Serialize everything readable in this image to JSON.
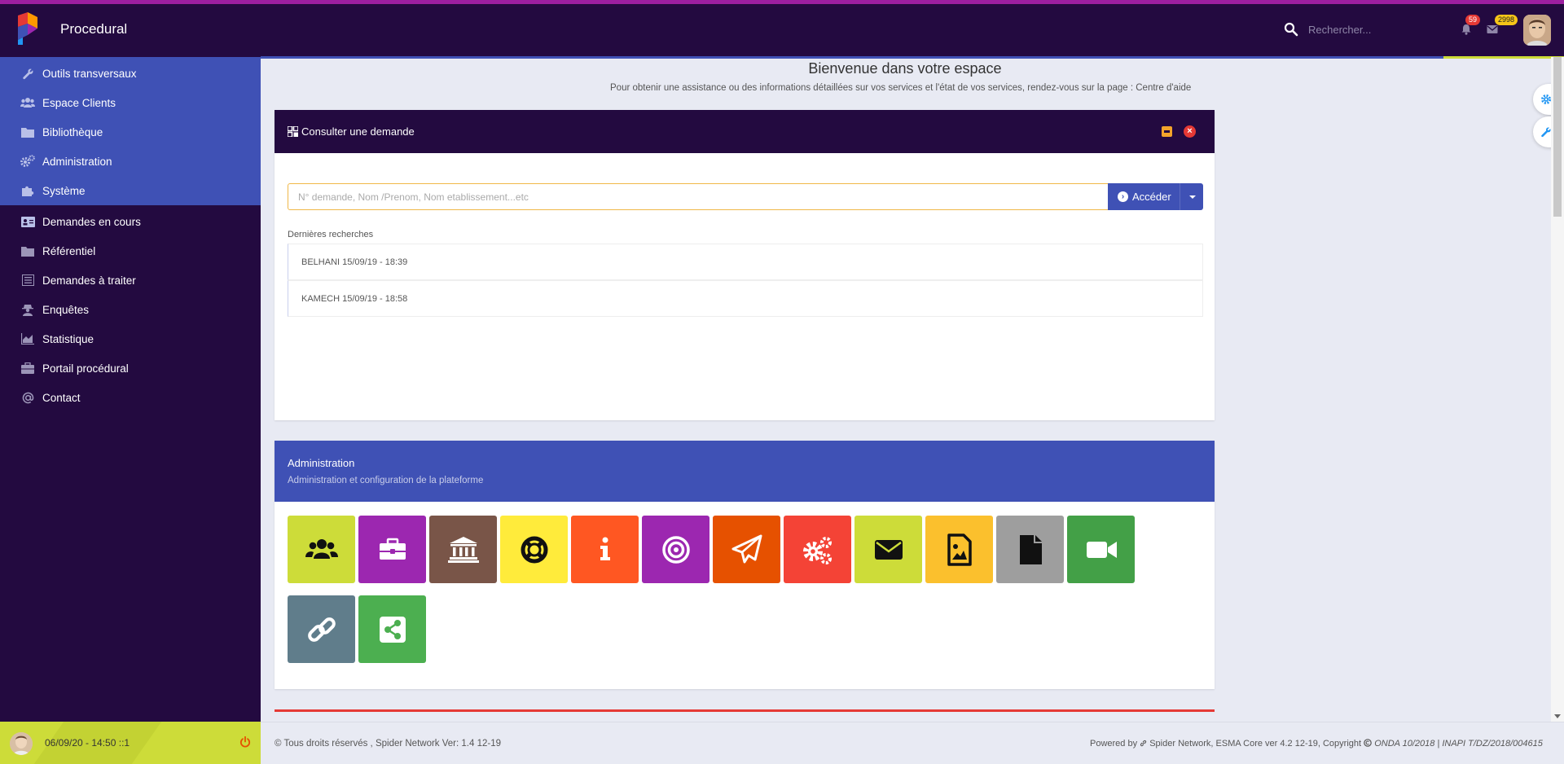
{
  "app": {
    "title": "Procedural"
  },
  "header": {
    "search_placeholder": "Rechercher...",
    "notifications_count": "59",
    "messages_count": "2998"
  },
  "sidebar": {
    "items": [
      {
        "label": "Outils transversaux",
        "icon": "wrench-icon"
      },
      {
        "label": "Espace Clients",
        "icon": "users-icon"
      },
      {
        "label": "Bibliothèque",
        "icon": "folder-icon"
      },
      {
        "label": "Administration",
        "icon": "cogs-icon"
      },
      {
        "label": "Système",
        "icon": "puzzle-icon"
      },
      {
        "label": "Demandes en cours",
        "icon": "id-card-icon"
      },
      {
        "label": "Référentiel",
        "icon": "folder-icon"
      },
      {
        "label": "Demandes à traiter",
        "icon": "list-icon"
      },
      {
        "label": "Enquêtes",
        "icon": "user-secret-icon"
      },
      {
        "label": "Statistique",
        "icon": "chart-area-icon"
      },
      {
        "label": "Portail procédural",
        "icon": "briefcase-icon"
      },
      {
        "label": "Contact",
        "icon": "at-icon"
      }
    ],
    "footer_datetime": "06/09/20 - 14:50 ::1"
  },
  "main": {
    "welcome": "Bienvenue dans votre espace",
    "help_text": "Pour obtenir une assistance ou des informations détaillées sur vos services et l'état de vos services, rendez-vous sur la page : Centre d'aide",
    "consult_panel": {
      "title": "Consulter une demande",
      "input_placeholder": "N° demande, Nom /Prenom, Nom etablissement...etc",
      "button_label": "Accéder",
      "recent_label": "Dernières recherches",
      "recent": [
        "BELHANI 15/09/19 - 18:39",
        "KAMECH 15/09/19 - 18:58"
      ]
    },
    "admin_panel": {
      "title": "Administration",
      "subtitle": "Administration et configuration de la plateforme",
      "tiles": [
        {
          "icon": "users-icon",
          "color": "#cddc39"
        },
        {
          "icon": "briefcase-icon",
          "color": "#9c27b0"
        },
        {
          "icon": "institution-icon",
          "color": "#795548"
        },
        {
          "icon": "life-ring-icon",
          "color": "#ffeb3b"
        },
        {
          "icon": "info-icon",
          "color": "#ff5722"
        },
        {
          "icon": "bullseye-icon",
          "color": "#9c27b0"
        },
        {
          "icon": "paper-plane-icon",
          "color": "#e65100"
        },
        {
          "icon": "cogs-icon",
          "color": "#f44336"
        },
        {
          "icon": "envelope-icon",
          "color": "#cddc39"
        },
        {
          "icon": "file-image-icon",
          "color": "#fbc02d"
        },
        {
          "icon": "file-icon",
          "color": "#9e9e9e"
        },
        {
          "icon": "video-icon",
          "color": "#43a047"
        },
        {
          "icon": "link-icon",
          "color": "#607d8b"
        },
        {
          "icon": "share-icon",
          "color": "#4caf50"
        }
      ]
    }
  },
  "footer": {
    "left": "© Tous droits réservés , Spider Network Ver: 1.4 12-19",
    "right_prefix": "Powered by",
    "right_company": "Spider Network, ESMA Core ver 4.2 12-19, Copyright",
    "right_italic": "ONDA 10/2018 | INAPI T/DZ/2018/004615"
  },
  "colors": {
    "dark": "#230a40",
    "primary": "#3f51b5",
    "lime": "#cddc39",
    "magenta": "#9c1fa0",
    "danger": "#e53935"
  }
}
